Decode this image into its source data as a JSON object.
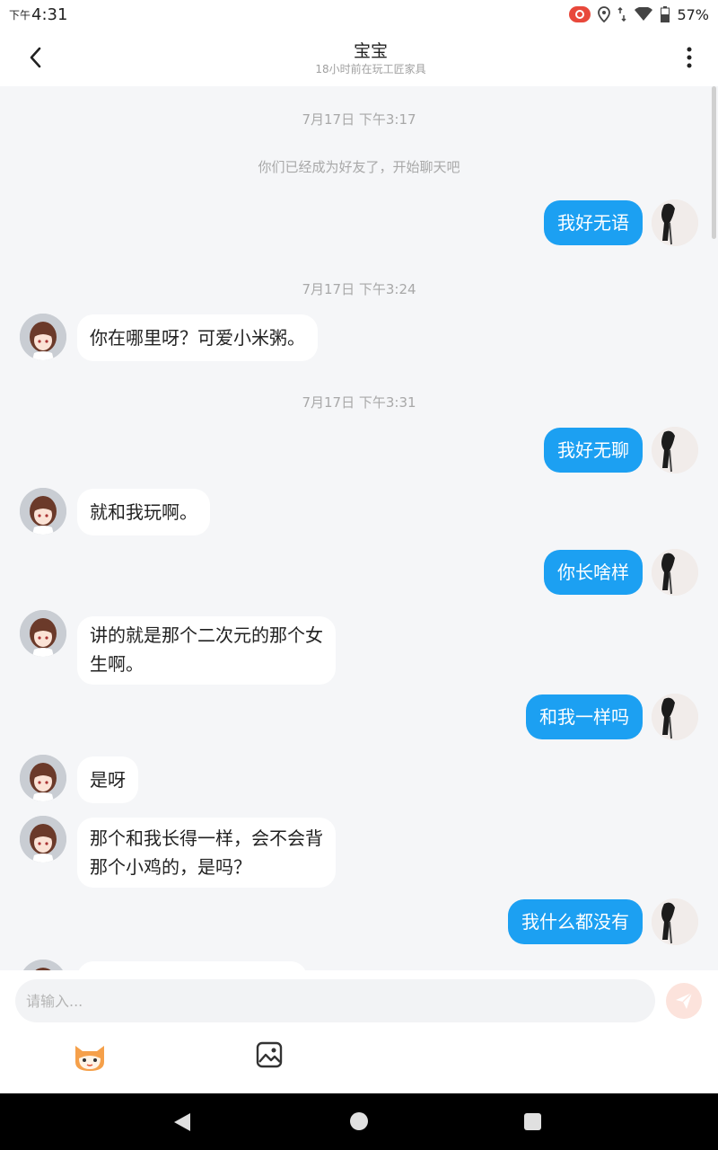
{
  "status_bar": {
    "time_prefix": "下午",
    "time": "4:31",
    "battery": "57%",
    "icons": [
      "screen-record-icon",
      "location-icon",
      "data-arrows-icon",
      "wifi-icon",
      "battery-icon"
    ]
  },
  "header": {
    "title": "宝宝",
    "subtitle": "18小时前在玩工匠家具",
    "back_icon": "chevron-left-icon",
    "more_icon": "more-vertical-icon"
  },
  "chat": {
    "timestamps": [
      "7月17日 下午3:17",
      "7月17日 下午3:24",
      "7月17日 下午3:31"
    ],
    "system_message": "你们已经成为好友了，开始聊天吧",
    "messages": [
      {
        "from": "me",
        "text": "我好无语"
      },
      {
        "from": "other",
        "text": "你在哪里呀？可爱小米粥。"
      },
      {
        "from": "me",
        "text": "我好无聊"
      },
      {
        "from": "other",
        "text": "就和我玩啊。"
      },
      {
        "from": "me",
        "text": "你长啥样"
      },
      {
        "from": "other",
        "lines": [
          "讲的就是那个二次元的那个女",
          "生啊。"
        ]
      },
      {
        "from": "me",
        "text": "和我一样吗"
      },
      {
        "from": "other",
        "text": "是呀"
      },
      {
        "from": "other",
        "lines": [
          "那个和我长得一样，会不会背",
          "那个小鸡的，是吗？"
        ]
      },
      {
        "from": "me",
        "text": "我什么都没有"
      }
    ]
  },
  "input": {
    "placeholder": "请输入...",
    "send_icon": "send-icon",
    "emoji_icon": "cat-face-icon",
    "image_icon": "image-icon"
  },
  "colors": {
    "accent": "#1ca0f2",
    "background": "#f5f6f8",
    "send_button": "#fce3dc"
  }
}
